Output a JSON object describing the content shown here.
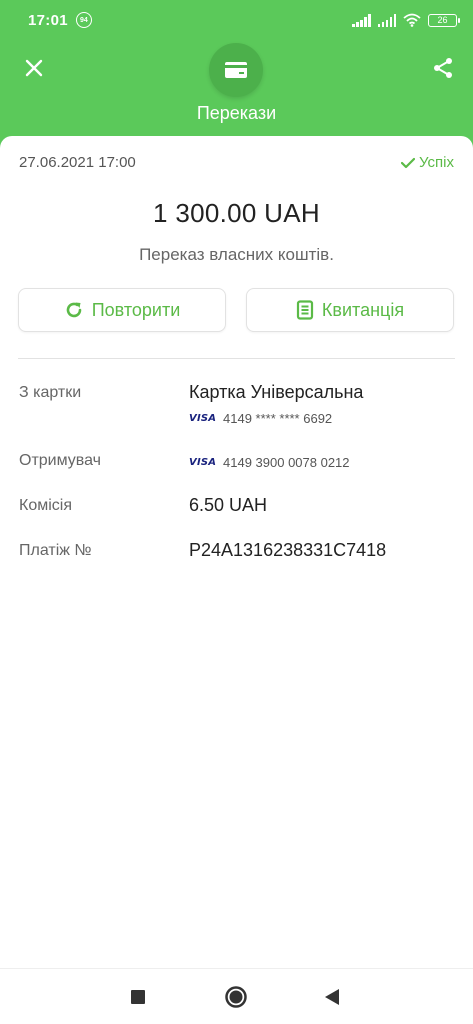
{
  "status_bar": {
    "time": "17:01",
    "notification_count": "94",
    "battery": "26"
  },
  "header": {
    "title": "Перекази",
    "accent_color": "#5bc95a"
  },
  "transaction": {
    "datetime": "27.06.2021 17:00",
    "status": "Успіх",
    "amount": "1 300.00 UAH",
    "description": "Переказ власних коштів."
  },
  "actions": {
    "repeat_label": "Повторити",
    "receipt_label": "Квитанція"
  },
  "details": {
    "from_label": "З картки",
    "from_card_name": "Картка Універсальна",
    "from_card_brand": "VISA",
    "from_card_number": "4149 **** **** 6692",
    "recipient_label": "Отримувач",
    "recipient_card_brand": "VISA",
    "recipient_card_number": "4149 3900 0078 0212",
    "fee_label": "Комісія",
    "fee_value": "6.50 UAH",
    "payment_label": "Платіж №",
    "payment_value": "P24A1316238331C7418"
  },
  "icons": {
    "close": "close-icon",
    "share": "share-icon",
    "header": "card-icon",
    "repeat": "refresh-icon",
    "receipt": "receipt-icon",
    "status": "check-icon"
  }
}
